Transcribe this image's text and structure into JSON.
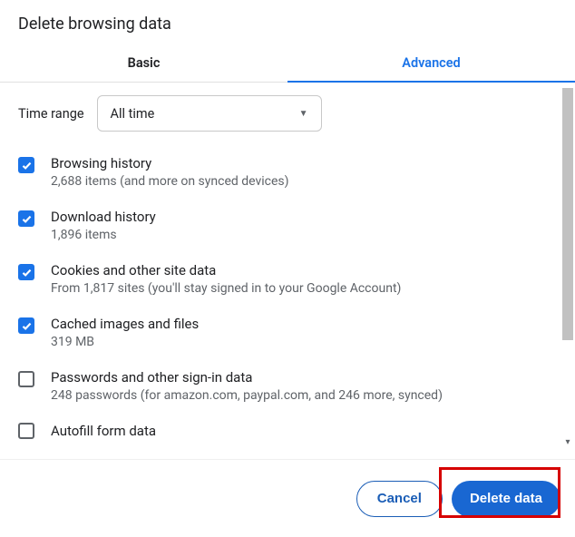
{
  "dialog": {
    "title": "Delete browsing data"
  },
  "tabs": {
    "basic": "Basic",
    "advanced": "Advanced"
  },
  "timerange": {
    "label": "Time range",
    "value": "All time"
  },
  "options": {
    "browsing": {
      "title": "Browsing history",
      "sub": "2,688 items (and more on synced devices)"
    },
    "download": {
      "title": "Download history",
      "sub": "1,896 items"
    },
    "cookies": {
      "title": "Cookies and other site data",
      "sub": "From 1,817 sites (you'll stay signed in to your Google Account)"
    },
    "cache": {
      "title": "Cached images and files",
      "sub": "319 MB"
    },
    "passwords": {
      "title": "Passwords and other sign-in data",
      "sub": "248 passwords (for amazon.com, paypal.com, and 246 more, synced)"
    },
    "autofill": {
      "title": "Autofill form data"
    }
  },
  "footer": {
    "cancel": "Cancel",
    "delete": "Delete data"
  }
}
